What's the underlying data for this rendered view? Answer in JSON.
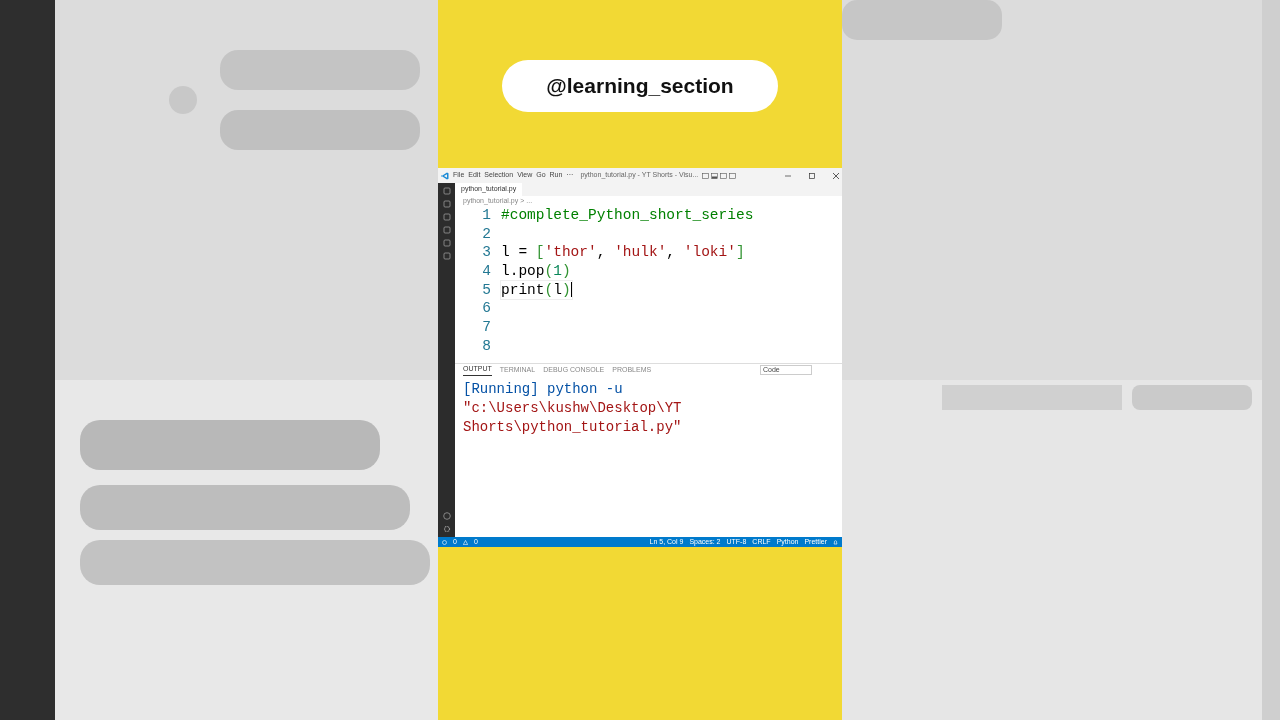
{
  "overlay": {
    "handle": "@learning_section"
  },
  "window": {
    "menu": [
      "File",
      "Edit",
      "Selection",
      "View",
      "Go",
      "Run",
      "···"
    ],
    "title": "python_tutorial.py - YT Shorts - Visu..."
  },
  "tabs": [
    {
      "label": "python_tutorial.py",
      "selected": true
    }
  ],
  "breadcrumb": "python_tutorial.py > ...",
  "editor": {
    "lines": [
      {
        "number": "1",
        "tokens": [
          {
            "kind": "comment",
            "text": "#complete_Python_short_series"
          }
        ]
      },
      {
        "number": "2"
      },
      {
        "number": "3",
        "tokens": [
          {
            "kind": "plain",
            "text": "l = "
          },
          {
            "kind": "bracket",
            "text": "["
          },
          {
            "kind": "string",
            "text": "'thor'"
          },
          {
            "kind": "plain",
            "text": ", "
          },
          {
            "kind": "string",
            "text": "'hulk'"
          },
          {
            "kind": "plain",
            "text": ", "
          },
          {
            "kind": "string",
            "text": "'loki'"
          },
          {
            "kind": "bracket",
            "text": "]"
          }
        ]
      },
      {
        "number": "4",
        "tokens": [
          {
            "kind": "plain",
            "text": "l.pop"
          },
          {
            "kind": "bracket",
            "text": "("
          },
          {
            "kind": "number",
            "text": "1"
          },
          {
            "kind": "bracket",
            "text": ")"
          }
        ]
      },
      {
        "number": "5",
        "current": true,
        "tokens": [
          {
            "kind": "plain",
            "text": "print"
          },
          {
            "kind": "bracket",
            "text": "("
          },
          {
            "kind": "plain",
            "text": "l"
          },
          {
            "kind": "bracket",
            "text": ")"
          }
        ]
      },
      {
        "number": "6"
      },
      {
        "number": "7"
      },
      {
        "number": "8"
      }
    ]
  },
  "panel": {
    "tabs": [
      {
        "label": "OUTPUT",
        "selected": true
      },
      {
        "label": "TERMINAL",
        "selected": false
      },
      {
        "label": "DEBUG CONSOLE",
        "selected": false
      },
      {
        "label": "PROBLEMS",
        "selected": false
      }
    ],
    "channel": "Code",
    "output": [
      "[Running] python -u",
      "\"c:\\Users\\kushw\\Desktop\\YT",
      "Shorts\\python_tutorial.py\""
    ]
  },
  "status_bar": {
    "errors": "0",
    "warnings": "0",
    "items": [
      "Ln 5, Col 9",
      "Spaces: 2",
      "UTF-8",
      "CRLF",
      "Python",
      "Prettier"
    ]
  }
}
